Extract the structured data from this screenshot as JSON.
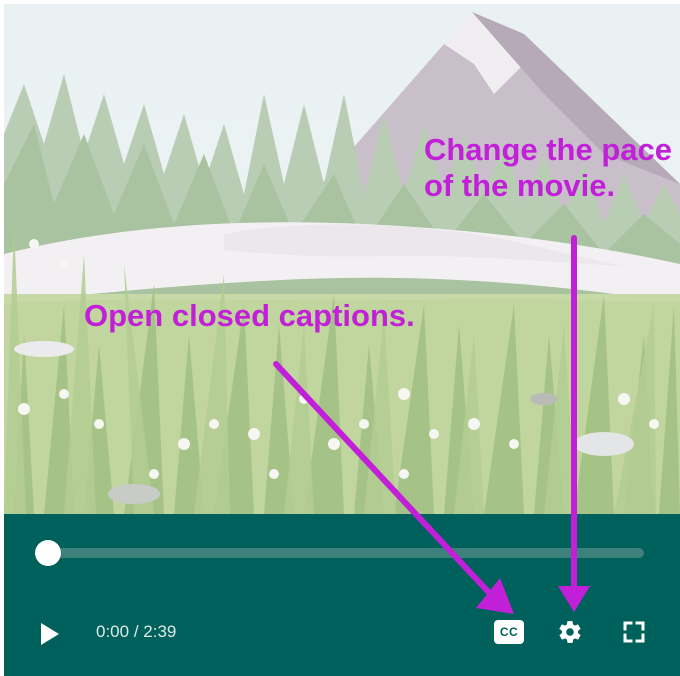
{
  "player": {
    "progress_fraction": 0.02,
    "time_current": "0:00",
    "time_separator": " / ",
    "time_total": "2:39",
    "cc_label": "CC",
    "icons": {
      "play": "play-icon",
      "captions": "closed-captions-icon",
      "settings": "gear-icon",
      "fullscreen": "fullscreen-icon"
    }
  },
  "annotations": {
    "pace_line1": "Change the pace",
    "pace_line2": "of the movie.",
    "captions": "Open closed captions."
  },
  "colors": {
    "control_bar": "#00605b",
    "progress_track": "#3d817c",
    "progress_fill": "#18b4a3",
    "annotation": "#c21fd9"
  }
}
